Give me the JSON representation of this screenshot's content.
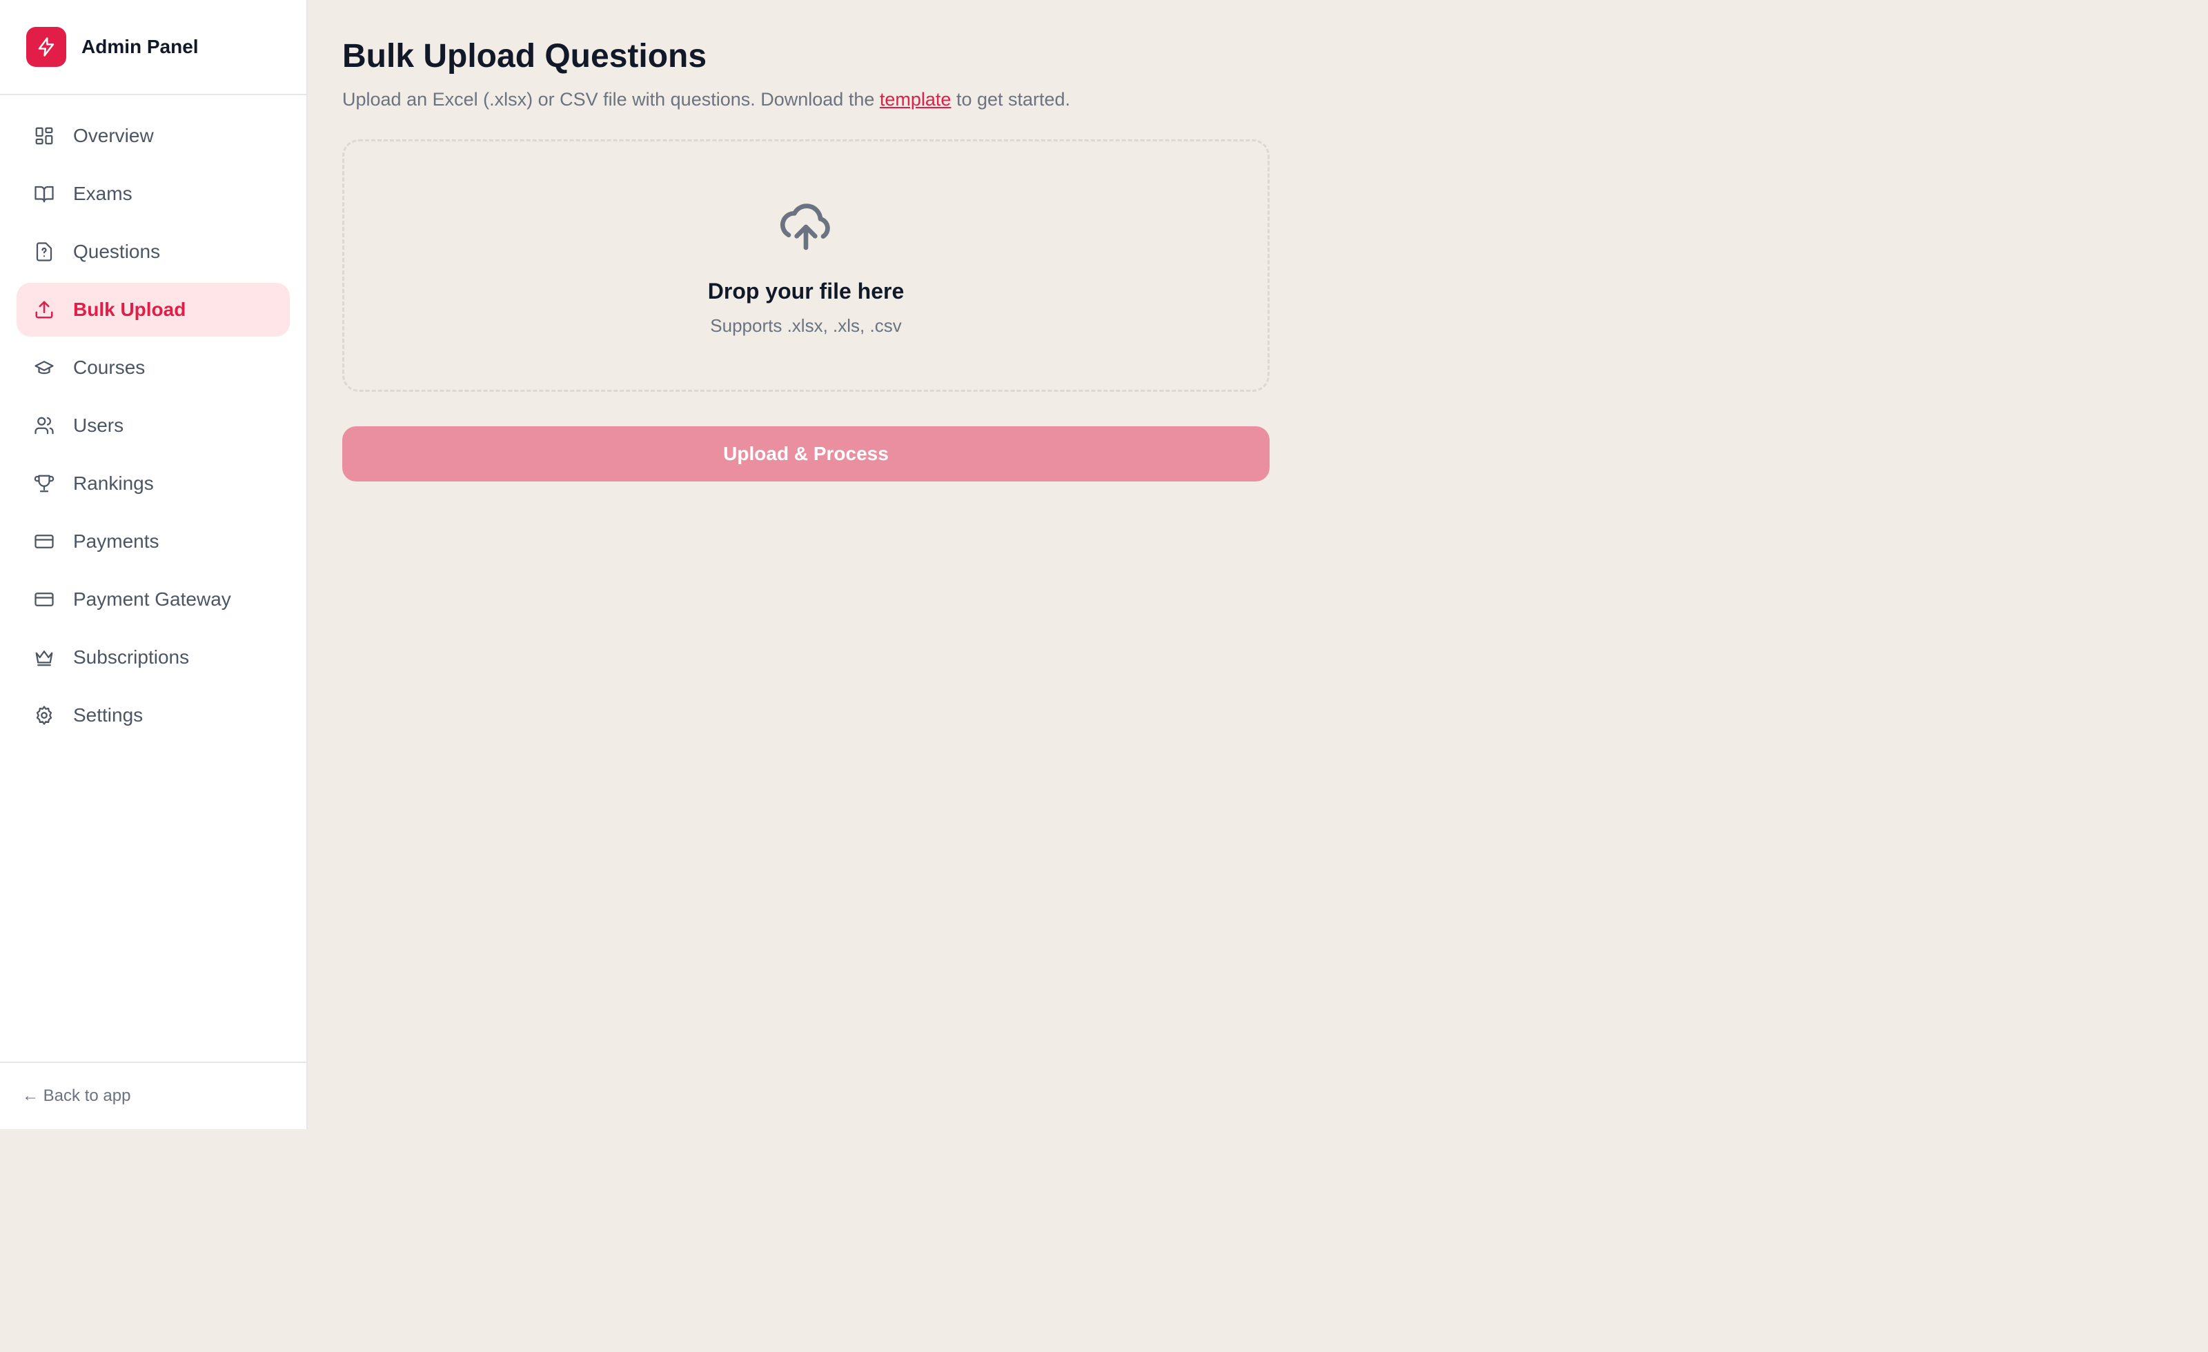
{
  "brand": {
    "title": "Admin Panel",
    "icon": "lightning-icon",
    "accent_color": "#e11d48"
  },
  "sidebar": {
    "items": [
      {
        "label": "Overview",
        "icon": "grid-icon",
        "active": false
      },
      {
        "label": "Exams",
        "icon": "book-open-icon",
        "active": false
      },
      {
        "label": "Questions",
        "icon": "file-question-icon",
        "active": false
      },
      {
        "label": "Bulk Upload",
        "icon": "upload-icon",
        "active": true
      },
      {
        "label": "Courses",
        "icon": "graduation-cap-icon",
        "active": false
      },
      {
        "label": "Users",
        "icon": "users-icon",
        "active": false
      },
      {
        "label": "Rankings",
        "icon": "trophy-icon",
        "active": false
      },
      {
        "label": "Payments",
        "icon": "credit-card-icon",
        "active": false
      },
      {
        "label": "Payment Gateway",
        "icon": "credit-card-icon",
        "active": false
      },
      {
        "label": "Subscriptions",
        "icon": "crown-icon",
        "active": false
      },
      {
        "label": "Settings",
        "icon": "gear-icon",
        "active": false
      }
    ],
    "footer_link": "← Back to app"
  },
  "main": {
    "title": "Bulk Upload Questions",
    "subtitle_before": "Upload an Excel (.xlsx) or CSV file with questions. Download the ",
    "subtitle_link": "template",
    "subtitle_after": " to get started.",
    "dropzone": {
      "icon": "cloud-upload-icon",
      "title": "Drop your file here",
      "subtitle": "Supports .xlsx, .xls, .csv"
    },
    "upload_button": "Upload & Process",
    "upload_button_color": "#ea8fa0"
  }
}
